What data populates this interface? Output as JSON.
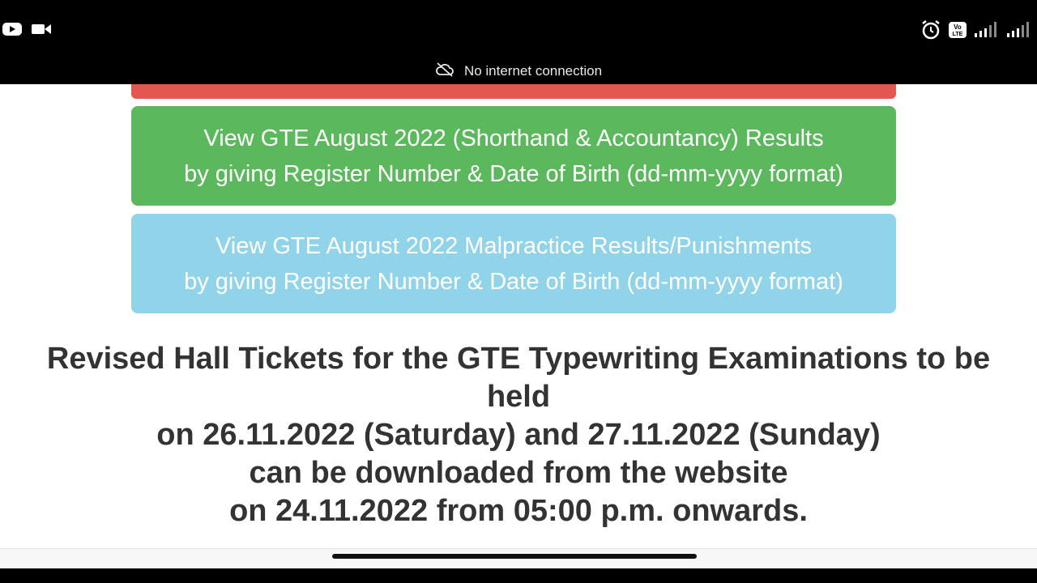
{
  "status_bar": {
    "left_icons": [
      "youtube-icon",
      "video-camera-icon"
    ],
    "right_icons": [
      "alarm-icon",
      "volte-icon",
      "signal-icon",
      "signal-icon"
    ],
    "volte_label": "Vo\nLTE"
  },
  "banner": {
    "icon": "cloud-off-icon",
    "text": "No internet connection"
  },
  "buttons": {
    "green": {
      "line1": "View GTE August 2022 (Shorthand & Accountancy) Results",
      "line2": "by giving Register Number & Date of Birth (dd-mm-yyyy format)",
      "color": "#5cb85c"
    },
    "blue": {
      "line1": "View GTE August 2022 Malpractice Results/Punishments",
      "line2": "by giving Register Number & Date of Birth (dd-mm-yyyy format)",
      "color": "#91d4e9"
    },
    "red": {
      "color": "#e2574f"
    }
  },
  "notice": {
    "line1": "Revised Hall Tickets for the GTE Typewriting Examinations to be held",
    "line2": "on 26.11.2022 (Saturday) and 27.11.2022 (Sunday)",
    "line3": "can be downloaded from the website",
    "line4": "on 24.11.2022 from 05:00 p.m. onwards."
  }
}
